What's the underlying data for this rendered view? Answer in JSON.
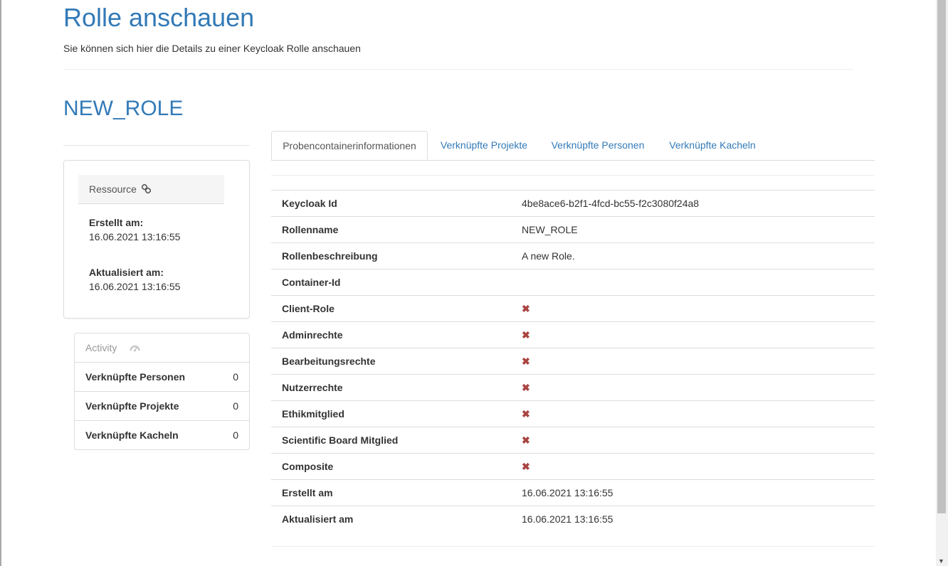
{
  "header": {
    "title": "Rolle anschauen",
    "subtitle": "Sie können sich hier die Details zu einer Keycloak Rolle anschauen"
  },
  "role": {
    "name": "NEW_ROLE"
  },
  "resource_panel": {
    "heading": "Ressource",
    "created_label": "Erstellt am:",
    "created_value": "16.06.2021 13:16:55",
    "updated_label": "Aktualisiert am:",
    "updated_value": "16.06.2021 13:16:55"
  },
  "activity_panel": {
    "heading": "Activity",
    "rows": [
      {
        "label": "Verknüpfte Personen",
        "count": "0"
      },
      {
        "label": "Verknüpfte Projekte",
        "count": "0"
      },
      {
        "label": "Verknüpfte Kacheln",
        "count": "0"
      }
    ]
  },
  "tabs": [
    {
      "label": "Probencontainerinformationen",
      "active": true
    },
    {
      "label": "Verknüpfte Projekte",
      "active": false
    },
    {
      "label": "Verknüpfte Personen",
      "active": false
    },
    {
      "label": "Verknüpfte Kacheln",
      "active": false
    }
  ],
  "properties": [
    {
      "key": "Keycloak Id",
      "value": "4be8ace6-b2f1-4fcd-bc55-f2c3080f24a8"
    },
    {
      "key": "Rollenname",
      "value": "NEW_ROLE"
    },
    {
      "key": "Rollenbeschreibung",
      "value": "A new Role."
    },
    {
      "key": "Container-Id",
      "value": ""
    },
    {
      "key": "Client-Role",
      "value": "✖"
    },
    {
      "key": "Adminrechte",
      "value": "✖"
    },
    {
      "key": "Bearbeitungsrechte",
      "value": "✖"
    },
    {
      "key": "Nutzerrechte",
      "value": "✖"
    },
    {
      "key": "Ethikmitglied",
      "value": "✖"
    },
    {
      "key": "Scientific Board Mitglied",
      "value": "✖"
    },
    {
      "key": "Composite",
      "value": "✖"
    },
    {
      "key": "Erstellt am",
      "value": "16.06.2021 13:16:55"
    },
    {
      "key": "Aktualisiert am",
      "value": "16.06.2021 13:16:55"
    }
  ],
  "icons": {
    "resource_link": "link-icon",
    "activity": "dashboard-gauge-icon",
    "false_mark": "times-icon"
  },
  "colors": {
    "link": "#337ab7",
    "false_mark": "#a94442"
  }
}
